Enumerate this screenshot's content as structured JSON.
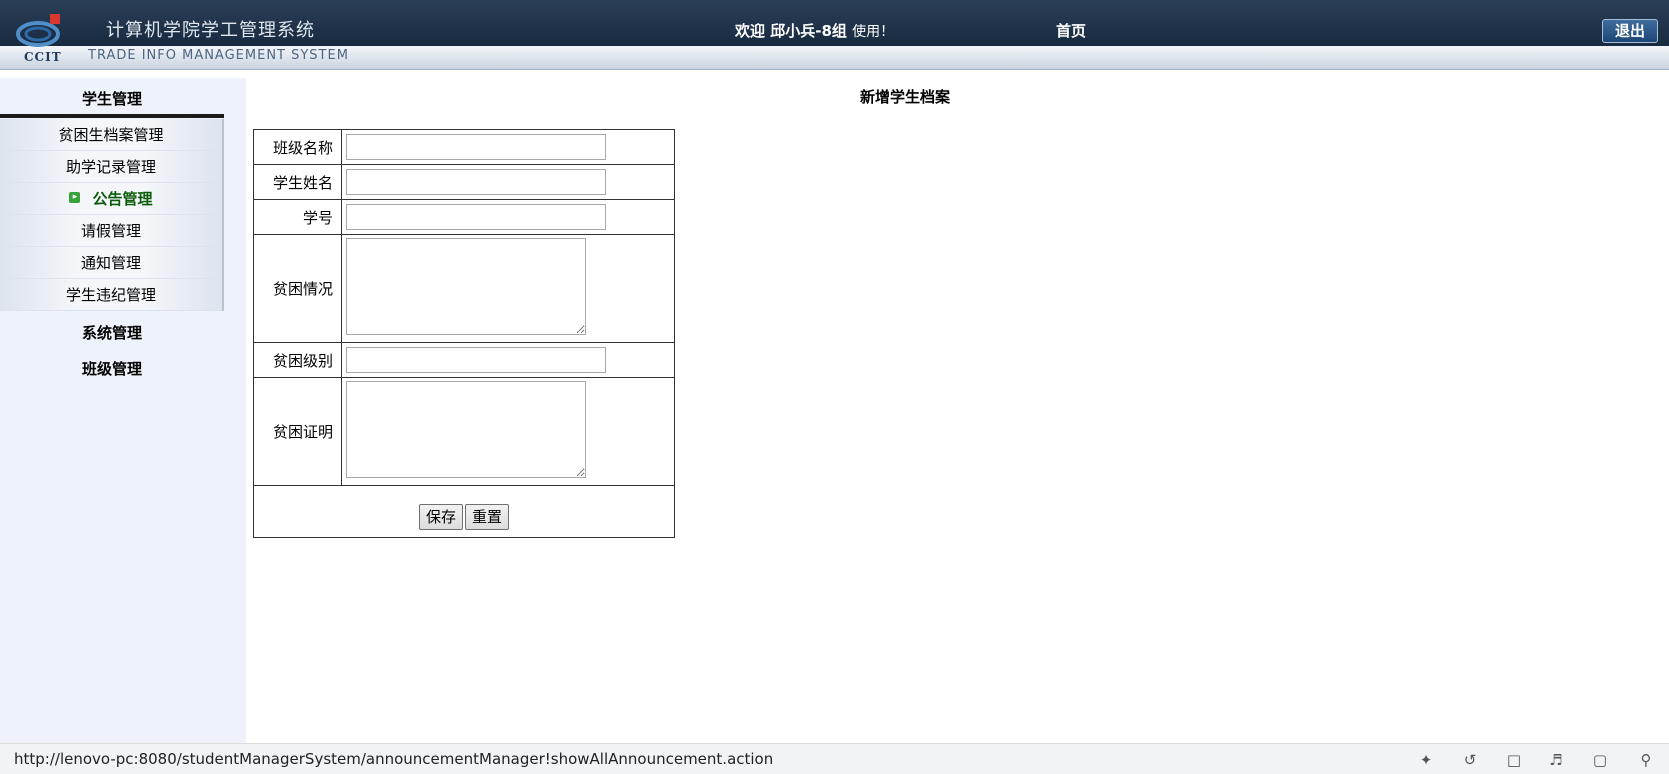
{
  "header": {
    "logo_text": "CCIT",
    "system_title": "计算机学院学工管理系统",
    "system_subtitle": "TRADE INFO MANAGEMENT SYSTEM",
    "welcome_prefix": "欢迎 邱小兵-8组",
    "welcome_suffix": "使用！",
    "home_label": "首页",
    "logout_label": "退出"
  },
  "sidebar": {
    "group_student": "学生管理",
    "items": [
      {
        "label": "贫困生档案管理"
      },
      {
        "label": "助学记录管理"
      },
      {
        "label": "公告管理"
      },
      {
        "label": "请假管理"
      },
      {
        "label": "通知管理"
      },
      {
        "label": "学生违纪管理"
      }
    ],
    "group_system": "系统管理",
    "group_class": "班级管理"
  },
  "main": {
    "page_title": "新增学生档案",
    "fields": {
      "class_name": {
        "label": "班级名称",
        "value": ""
      },
      "student_name": {
        "label": "学生姓名",
        "value": ""
      },
      "student_id": {
        "label": "学号",
        "value": ""
      },
      "poverty_status": {
        "label": "贫困情况",
        "value": ""
      },
      "poverty_level": {
        "label": "贫困级别",
        "value": ""
      },
      "poverty_proof": {
        "label": "贫困证明",
        "value": ""
      }
    },
    "save_label": "保存",
    "reset_label": "重置"
  },
  "statusbar": {
    "url": "http://lenovo-pc:8080/studentManagerSystem/announcementManager!showAllAnnouncement.action"
  },
  "colors": {
    "header_dark": "#1f3349",
    "sidebar_bg": "#eef2fb",
    "active_menu": "#0b5b0b"
  }
}
